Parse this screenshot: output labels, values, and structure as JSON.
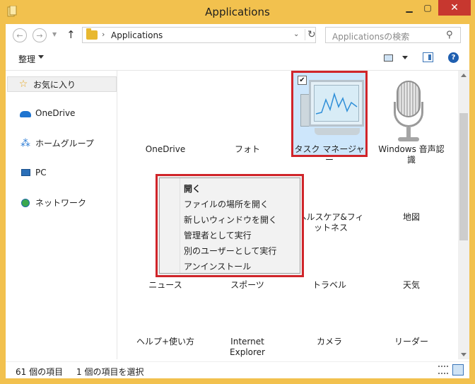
{
  "window": {
    "title": "Applications"
  },
  "address": {
    "path": "Applications",
    "search_placeholder": "Applicationsの検索"
  },
  "toolbar": {
    "organize": "整理"
  },
  "nav": {
    "favorites": "お気に入り",
    "onedrive": "OneDrive",
    "homegroup": "ホームグループ",
    "pc": "PC",
    "network": "ネットワーク"
  },
  "items": {
    "onedrive": "OneDrive",
    "photo": "フォト",
    "task_manager": "タスク マネージャー",
    "voice_recognition": "Windows 音声認識",
    "health_fitness": "ヘルスケア&フィットネス",
    "maps": "地図",
    "news": "ニュース",
    "sports": "スポーツ",
    "travel": "トラベル",
    "weather": "天気",
    "help": "ヘルプ+使い方",
    "internet_explorer": "Internet Explorer",
    "camera": "カメラ",
    "reader": "リーダー"
  },
  "context_menu": {
    "items": [
      "開く",
      "ファイルの場所を開く",
      "新しいウィンドウを開く",
      "管理者として実行",
      "別のユーザーとして実行",
      "アンインストール"
    ]
  },
  "status": {
    "item_count": "61 個の項目",
    "selected": "1 個の項目を選択"
  },
  "colors": {
    "frame": "#f2c14e",
    "highlight": "#d0252a",
    "selection": "#cde6fb"
  }
}
